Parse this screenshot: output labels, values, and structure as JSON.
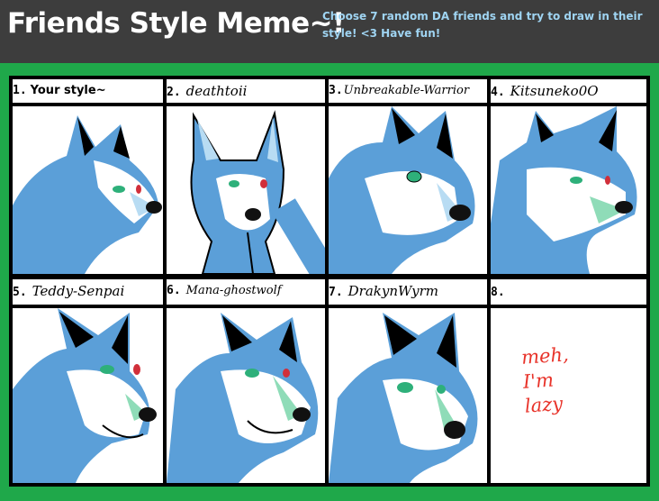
{
  "header": {
    "title": "Friends Style Meme~!",
    "subtitle": "Choose 7 random DA friends and try to draw in their style! <3 Have fun!"
  },
  "cells": [
    {
      "number": "1.",
      "name": "Your style~",
      "name_style": "plain"
    },
    {
      "number": "2.",
      "name": "deathtoii"
    },
    {
      "number": "3.",
      "name": "Unbreakable-Warrior"
    },
    {
      "number": "4.",
      "name": "Kitsuneko0O"
    },
    {
      "number": "5.",
      "name": "Teddy-Senpai"
    },
    {
      "number": "6.",
      "name": "Mana-ghostwolf"
    },
    {
      "number": "7.",
      "name": "DrakynWyrm"
    },
    {
      "number": "8.",
      "name": ""
    }
  ],
  "cell8_note": "meh,\nI'm\nlazy",
  "colors": {
    "background": "#1fa84a",
    "header_bg": "#3d3d3d",
    "subtitle": "#9fd4f2",
    "wolf_blue": "#5b9fd8",
    "wolf_light": "#b8dcf3",
    "note_red": "#e8332a"
  }
}
